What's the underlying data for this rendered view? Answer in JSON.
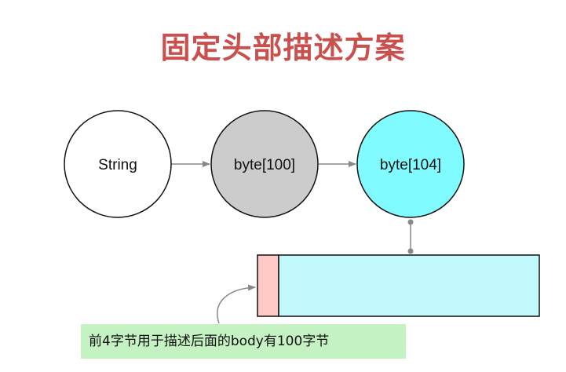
{
  "title": "固定头部描述方案",
  "nodes": [
    {
      "label": "String",
      "fill": "#ffffff"
    },
    {
      "label": "byte[100]",
      "fill": "#cccccc"
    },
    {
      "label": "byte[104]",
      "fill": "#80fbff"
    }
  ],
  "buffer": {
    "header_color": "#ffc9c5",
    "body_color": "#c2f9fd"
  },
  "caption": "前4字节用于描述后面的body有100字节",
  "colors": {
    "title": "#c9504c",
    "stroke": "#111111",
    "arrow": "#888888",
    "caption_bg": "#c4f2c2"
  }
}
